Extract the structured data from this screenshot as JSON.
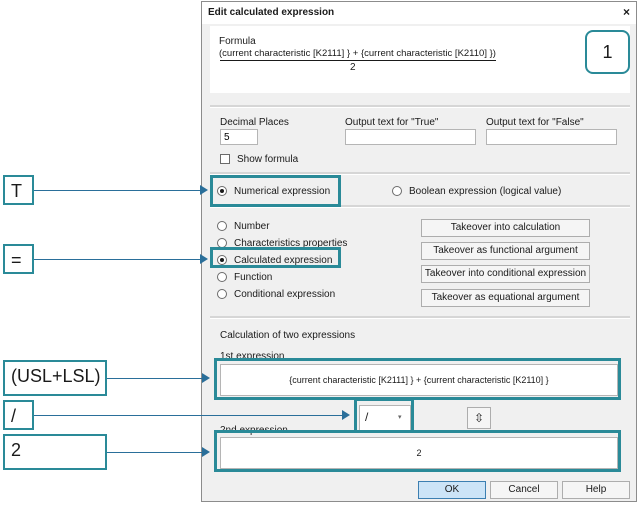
{
  "dialog": {
    "title": "Edit calculated expression",
    "close_glyph": "×",
    "formula": {
      "label": "Formula",
      "numerator": "(current characteristic [K2111] } + {current characteristic [K2110] })",
      "denominator": "2",
      "badge": "1"
    },
    "decimal": {
      "label": "Decimal Places",
      "value": "5",
      "true_label": "Output text for \"True\"",
      "true_value": "",
      "false_label": "Output text for \"False\"",
      "false_value": "",
      "show_formula_label": "Show formula"
    },
    "expr_type": {
      "numerical": "Numerical expression",
      "boolean": "Boolean expression (logical value)"
    },
    "types": {
      "number": "Number",
      "characteristics": "Characteristics properties",
      "calculated": "Calculated expression",
      "function": "Function",
      "conditional": "Conditional expression"
    },
    "takeover": {
      "calc": "Takeover into calculation",
      "functional": "Takeover as functional argument",
      "conditional": "Takeover into conditional expression",
      "equational": "Takeover as equational argument"
    },
    "calc_two": {
      "heading": "Calculation of two expressions",
      "first_label": "1st expression",
      "first_value": "{current characteristic [K2111] } + {current characteristic [K2110] }",
      "operator": "/",
      "operator_chevron": "▾",
      "swap_glyph": "⇳",
      "second_label": "2nd expression",
      "second_value": "2"
    },
    "footer": {
      "ok": "OK",
      "cancel": "Cancel",
      "help": "Help"
    }
  },
  "callouts": {
    "t": "T",
    "eq": "=",
    "usl_lsl": "(USL+LSL)",
    "slash": "/",
    "two": "2"
  },
  "colors": {
    "callout_border": "#2a8a98",
    "arrow": "#2a6f9a",
    "ok_button": "#cce4f7"
  }
}
